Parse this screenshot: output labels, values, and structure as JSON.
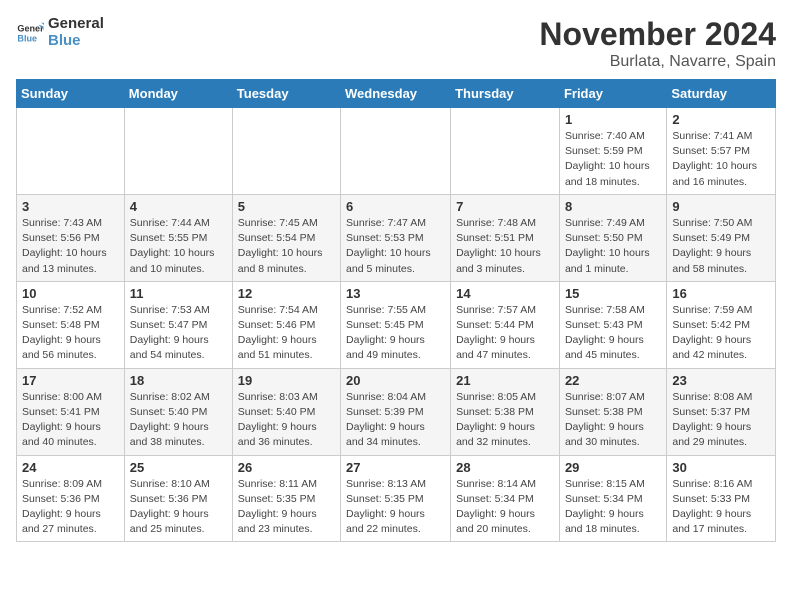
{
  "logo": {
    "line1": "General",
    "line2": "Blue"
  },
  "title": "November 2024",
  "subtitle": "Burlata, Navarre, Spain",
  "days_header": [
    "Sunday",
    "Monday",
    "Tuesday",
    "Wednesday",
    "Thursday",
    "Friday",
    "Saturday"
  ],
  "weeks": [
    [
      {
        "day": "",
        "info": ""
      },
      {
        "day": "",
        "info": ""
      },
      {
        "day": "",
        "info": ""
      },
      {
        "day": "",
        "info": ""
      },
      {
        "day": "",
        "info": ""
      },
      {
        "day": "1",
        "info": "Sunrise: 7:40 AM\nSunset: 5:59 PM\nDaylight: 10 hours and 18 minutes."
      },
      {
        "day": "2",
        "info": "Sunrise: 7:41 AM\nSunset: 5:57 PM\nDaylight: 10 hours and 16 minutes."
      }
    ],
    [
      {
        "day": "3",
        "info": "Sunrise: 7:43 AM\nSunset: 5:56 PM\nDaylight: 10 hours and 13 minutes."
      },
      {
        "day": "4",
        "info": "Sunrise: 7:44 AM\nSunset: 5:55 PM\nDaylight: 10 hours and 10 minutes."
      },
      {
        "day": "5",
        "info": "Sunrise: 7:45 AM\nSunset: 5:54 PM\nDaylight: 10 hours and 8 minutes."
      },
      {
        "day": "6",
        "info": "Sunrise: 7:47 AM\nSunset: 5:53 PM\nDaylight: 10 hours and 5 minutes."
      },
      {
        "day": "7",
        "info": "Sunrise: 7:48 AM\nSunset: 5:51 PM\nDaylight: 10 hours and 3 minutes."
      },
      {
        "day": "8",
        "info": "Sunrise: 7:49 AM\nSunset: 5:50 PM\nDaylight: 10 hours and 1 minute."
      },
      {
        "day": "9",
        "info": "Sunrise: 7:50 AM\nSunset: 5:49 PM\nDaylight: 9 hours and 58 minutes."
      }
    ],
    [
      {
        "day": "10",
        "info": "Sunrise: 7:52 AM\nSunset: 5:48 PM\nDaylight: 9 hours and 56 minutes."
      },
      {
        "day": "11",
        "info": "Sunrise: 7:53 AM\nSunset: 5:47 PM\nDaylight: 9 hours and 54 minutes."
      },
      {
        "day": "12",
        "info": "Sunrise: 7:54 AM\nSunset: 5:46 PM\nDaylight: 9 hours and 51 minutes."
      },
      {
        "day": "13",
        "info": "Sunrise: 7:55 AM\nSunset: 5:45 PM\nDaylight: 9 hours and 49 minutes."
      },
      {
        "day": "14",
        "info": "Sunrise: 7:57 AM\nSunset: 5:44 PM\nDaylight: 9 hours and 47 minutes."
      },
      {
        "day": "15",
        "info": "Sunrise: 7:58 AM\nSunset: 5:43 PM\nDaylight: 9 hours and 45 minutes."
      },
      {
        "day": "16",
        "info": "Sunrise: 7:59 AM\nSunset: 5:42 PM\nDaylight: 9 hours and 42 minutes."
      }
    ],
    [
      {
        "day": "17",
        "info": "Sunrise: 8:00 AM\nSunset: 5:41 PM\nDaylight: 9 hours and 40 minutes."
      },
      {
        "day": "18",
        "info": "Sunrise: 8:02 AM\nSunset: 5:40 PM\nDaylight: 9 hours and 38 minutes."
      },
      {
        "day": "19",
        "info": "Sunrise: 8:03 AM\nSunset: 5:40 PM\nDaylight: 9 hours and 36 minutes."
      },
      {
        "day": "20",
        "info": "Sunrise: 8:04 AM\nSunset: 5:39 PM\nDaylight: 9 hours and 34 minutes."
      },
      {
        "day": "21",
        "info": "Sunrise: 8:05 AM\nSunset: 5:38 PM\nDaylight: 9 hours and 32 minutes."
      },
      {
        "day": "22",
        "info": "Sunrise: 8:07 AM\nSunset: 5:38 PM\nDaylight: 9 hours and 30 minutes."
      },
      {
        "day": "23",
        "info": "Sunrise: 8:08 AM\nSunset: 5:37 PM\nDaylight: 9 hours and 29 minutes."
      }
    ],
    [
      {
        "day": "24",
        "info": "Sunrise: 8:09 AM\nSunset: 5:36 PM\nDaylight: 9 hours and 27 minutes."
      },
      {
        "day": "25",
        "info": "Sunrise: 8:10 AM\nSunset: 5:36 PM\nDaylight: 9 hours and 25 minutes."
      },
      {
        "day": "26",
        "info": "Sunrise: 8:11 AM\nSunset: 5:35 PM\nDaylight: 9 hours and 23 minutes."
      },
      {
        "day": "27",
        "info": "Sunrise: 8:13 AM\nSunset: 5:35 PM\nDaylight: 9 hours and 22 minutes."
      },
      {
        "day": "28",
        "info": "Sunrise: 8:14 AM\nSunset: 5:34 PM\nDaylight: 9 hours and 20 minutes."
      },
      {
        "day": "29",
        "info": "Sunrise: 8:15 AM\nSunset: 5:34 PM\nDaylight: 9 hours and 18 minutes."
      },
      {
        "day": "30",
        "info": "Sunrise: 8:16 AM\nSunset: 5:33 PM\nDaylight: 9 hours and 17 minutes."
      }
    ]
  ]
}
